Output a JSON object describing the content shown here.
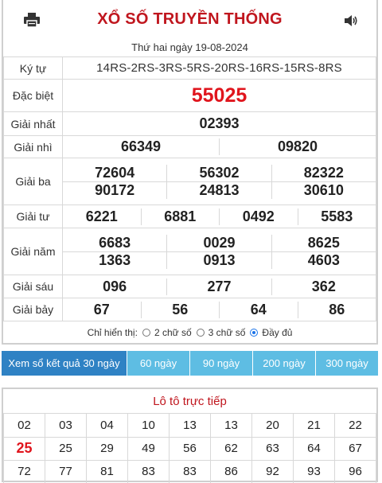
{
  "header": {
    "title": "XỔ SỐ TRUYỀN THỐNG",
    "print_icon": "printer-icon",
    "sound_icon": "speaker-icon"
  },
  "date": "Thứ hai ngày 19-08-2024",
  "results": {
    "codes_label": "Ký tự",
    "codes": "14RS-2RS-3RS-5RS-20RS-16RS-15RS-8RS",
    "special_label": "Đặc biệt",
    "special": "55025",
    "first_label": "Giải nhất",
    "first": "02393",
    "second_label": "Giải nhì",
    "second": [
      "66349",
      "09820"
    ],
    "third_label": "Giải ba",
    "third": [
      "72604",
      "56302",
      "82322",
      "90172",
      "24813",
      "30610"
    ],
    "fourth_label": "Giải tư",
    "fourth": [
      "6221",
      "6881",
      "0492",
      "5583"
    ],
    "fifth_label": "Giải năm",
    "fifth": [
      "6683",
      "0029",
      "8625",
      "1363",
      "0913",
      "4603"
    ],
    "sixth_label": "Giải sáu",
    "sixth": [
      "096",
      "277",
      "362"
    ],
    "seventh_label": "Giải bảy",
    "seventh": [
      "67",
      "56",
      "64",
      "86"
    ]
  },
  "display_options": {
    "label": "Chỉ hiển thị:",
    "options": [
      "2 chữ số",
      "3 chữ số",
      "Đầy đủ"
    ],
    "selected": "Đầy đủ"
  },
  "tabs": [
    "Xem sổ kết quả 30 ngày",
    "60 ngày",
    "90 ngày",
    "200 ngày",
    "300 ngày"
  ],
  "active_tab": "Xem sổ kết quả 30 ngày",
  "loto": {
    "title": "Lô tô trực tiếp",
    "rows": [
      [
        "02",
        "03",
        "04",
        "10",
        "13",
        "13",
        "20",
        "21",
        "22"
      ],
      [
        "25",
        "25",
        "29",
        "49",
        "56",
        "62",
        "63",
        "64",
        "67"
      ],
      [
        "72",
        "77",
        "81",
        "83",
        "83",
        "86",
        "92",
        "93",
        "96"
      ]
    ],
    "highlighted": "25"
  },
  "colors": {
    "title_red": "#c0161e",
    "special_red": "#e0151d",
    "tab_bg": "#5ebde3",
    "tab_active": "#2f82c4"
  }
}
